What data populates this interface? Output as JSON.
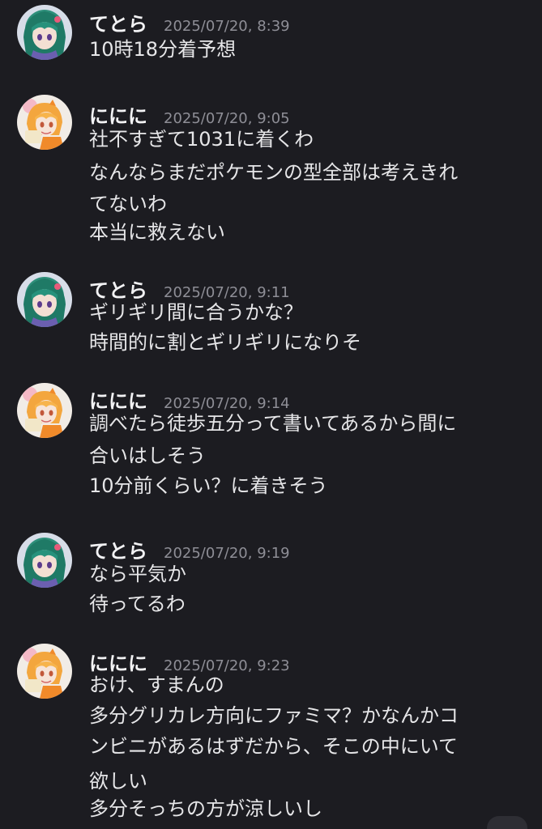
{
  "users": {
    "tora": {
      "name": "てとら",
      "icon": "green-hair-avatar-icon"
    },
    "ninini": {
      "name": "ににに",
      "icon": "orange-hair-avatar-icon"
    }
  },
  "messages": [
    {
      "author": "てとら",
      "time": "2025/07/20, 8:39",
      "lines": [
        "10時18分着予想"
      ]
    },
    {
      "author": "ににに",
      "time": "2025/07/20, 9:05",
      "lines": [
        "社不すぎて1031に着くわ",
        "なんならまだポケモンの型全部は考えきれ",
        "てないわ",
        "本当に救えない"
      ]
    },
    {
      "author": "てとら",
      "time": "2025/07/20, 9:11",
      "lines": [
        "ギリギリ間に合うかな？",
        "時間的に割とギリギリになりそ"
      ]
    },
    {
      "author": "ににに",
      "time": "2025/07/20, 9:14",
      "lines": [
        "調べたら徒歩五分って書いてあるから間に",
        "合いはしそう",
        "10分前くらい？に着きそう"
      ]
    },
    {
      "author": "てとら",
      "time": "2025/07/20, 9:19",
      "lines": [
        "なら平気か",
        "待ってるわ"
      ]
    },
    {
      "author": "ににに",
      "time": "2025/07/20, 9:23",
      "lines": [
        "おけ、すまんの",
        "多分グリカレ方向にファミマ？かなんかコ",
        "ンビニがあるはずだから、そこの中にいて",
        "欲しい",
        "多分そっちの方が涼しいし"
      ]
    }
  ],
  "colors": {
    "background": "#1c1c21",
    "name": "#f2f2f4",
    "timestamp": "#8e8e96",
    "text": "#e6e6e8"
  }
}
